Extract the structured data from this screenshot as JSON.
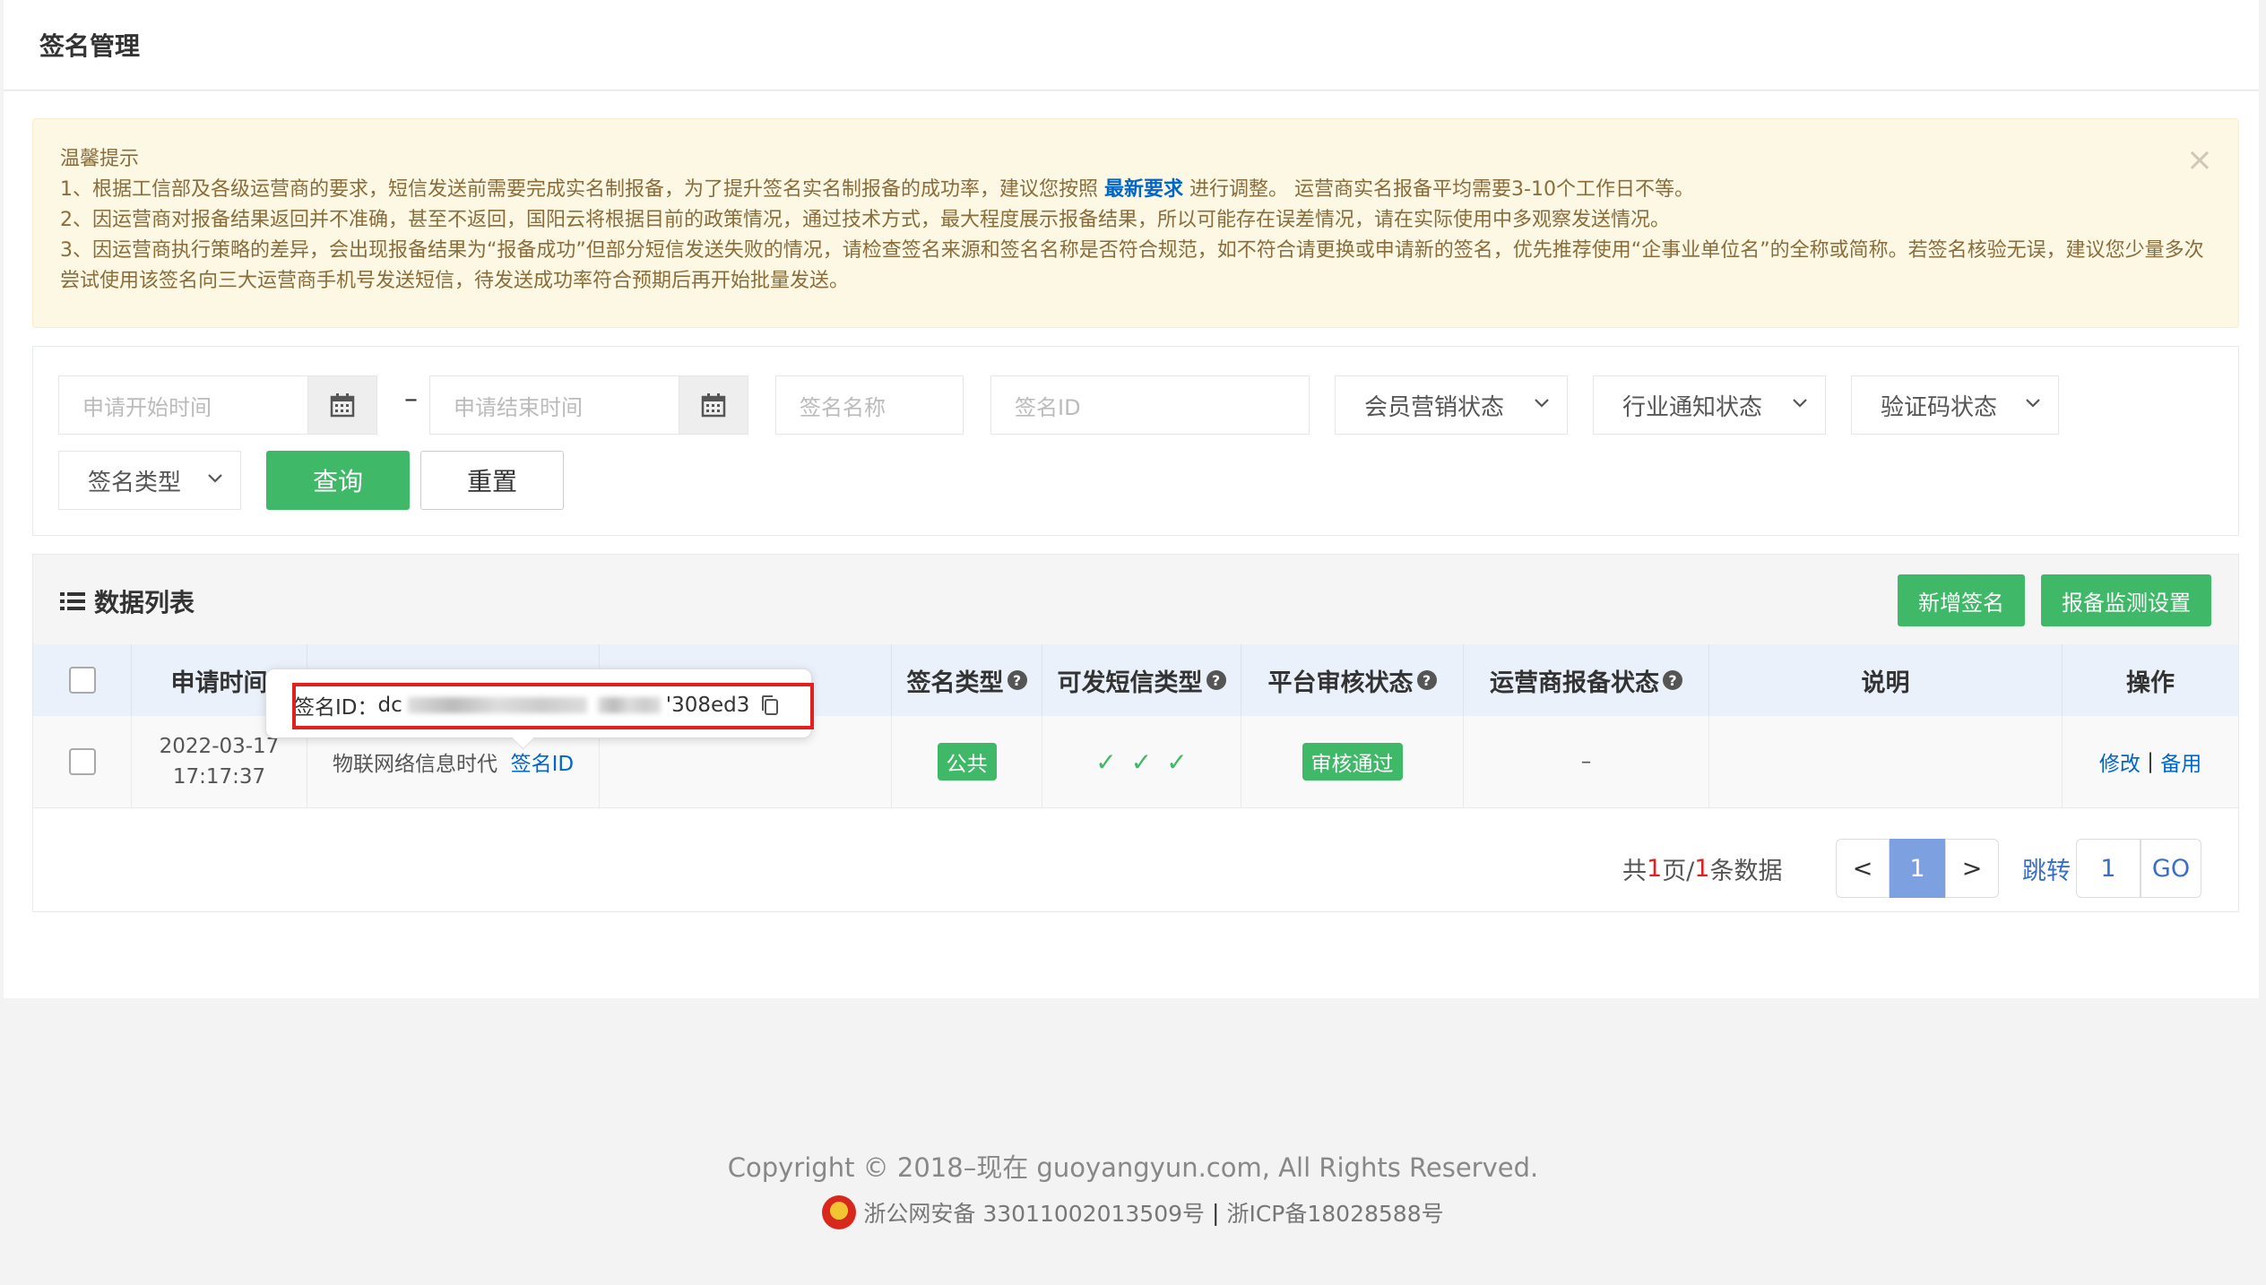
{
  "header": {
    "title": "签名管理"
  },
  "notice": {
    "title": "温馨提示",
    "line1_a": "1、根据工信部及各级运营商的要求，短信发送前需要完成实名制报备，为了提升签名实名制报备的成功率，建议您按照",
    "line1_link": "最新要求",
    "line1_b": "进行调整。 运营商实名报备平均需要3-10个工作日不等。",
    "line2": "2、因运营商对报备结果返回并不准确，甚至不返回，国阳云将根据目前的政策情况，通过技术方式，最大程度展示报备结果，所以可能存在误差情况，请在实际使用中多观察发送情况。",
    "line3": "3、因运营商执行策略的差异，会出现报备结果为“报备成功”但部分短信发送失败的情况，请检查签名来源和签名名称是否符合规范，如不符合请更换或申请新的签名，优先推荐使用“企事业单位名”的全称或简称。若签名核验无误，建议您少量多次尝试使用该签名向三大运营商手机号发送短信，待发送成功率符合预期后再开始批量发送。",
    "close": "×"
  },
  "filter": {
    "start_placeholder": "申请开始时间",
    "end_placeholder": "申请结束时间",
    "dash": "–",
    "name_placeholder": "签名名称",
    "id_placeholder": "签名ID",
    "member_status": "会员营销状态",
    "industry_status": "行业通知状态",
    "code_status": "验证码状态",
    "sign_type": "签名类型",
    "query": "查询",
    "reset": "重置"
  },
  "list": {
    "title": "数据列表",
    "add_button": "新增签名",
    "monitor_button": "报备监测设置",
    "columns": {
      "apply_time": "申请时间",
      "sign_type": "签名类型",
      "sms_type": "可发短信类型",
      "platform_status": "平台审核状态",
      "carrier_status": "运营商报备状态",
      "desc": "说明",
      "ops": "操作"
    },
    "rows": [
      {
        "date": "2022-03-17",
        "time": "17:17:37",
        "name": "物联网络信息时代",
        "id_link": "签名ID",
        "type": "公共",
        "platform_status": "审核通过",
        "carrier_status": "–",
        "edit": "修改",
        "sep": "|",
        "backup": "备用"
      }
    ],
    "tooltip": {
      "label": "签名ID：",
      "prefix": "dc",
      "suffix": "'308ed3"
    }
  },
  "pager": {
    "summary_a": "共",
    "total_pages": "1",
    "summary_b": "页/",
    "total_items": "1",
    "summary_c": "条数据",
    "prev": "<",
    "current": "1",
    "next": ">",
    "jump_label": "跳转",
    "jump_value": "1",
    "go": "GO"
  },
  "footer": {
    "copyright": "Copyright © 2018–现在 guoyangyun.com, All Rights Reserved.",
    "police": "浙公网安备 33011002013509号",
    "divider": "|",
    "icp": "浙ICP备18028588号"
  },
  "colors": {
    "accent_green": "#3fb867",
    "link_blue": "#0066cc",
    "highlight_red": "#e32020"
  }
}
